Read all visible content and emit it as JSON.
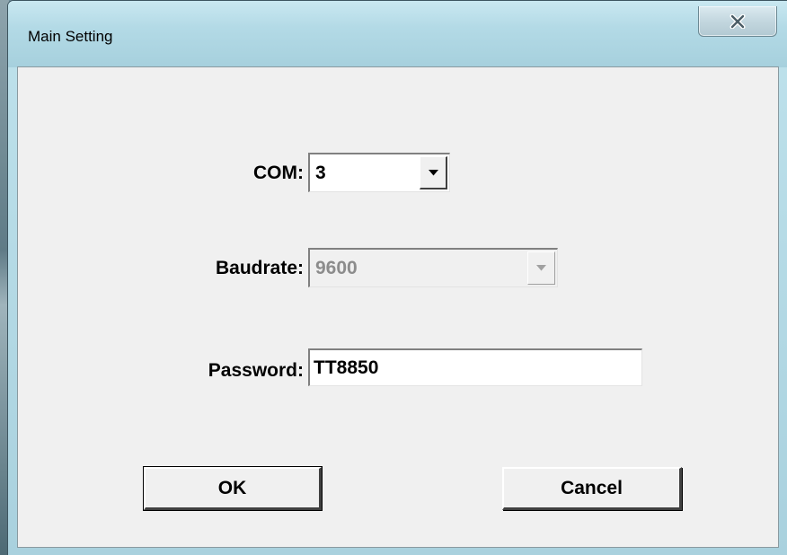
{
  "window": {
    "title": "Main Setting",
    "close_icon": "close-icon"
  },
  "form": {
    "com": {
      "label": "COM:",
      "value": "3",
      "icon": "chevron-down-icon"
    },
    "baudrate": {
      "label": "Baudrate:",
      "value": "9600",
      "enabled": false,
      "icon": "chevron-down-icon"
    },
    "password": {
      "label": "Password:",
      "value": "TT8850"
    }
  },
  "buttons": {
    "ok_label": "OK",
    "cancel_label": "Cancel"
  }
}
